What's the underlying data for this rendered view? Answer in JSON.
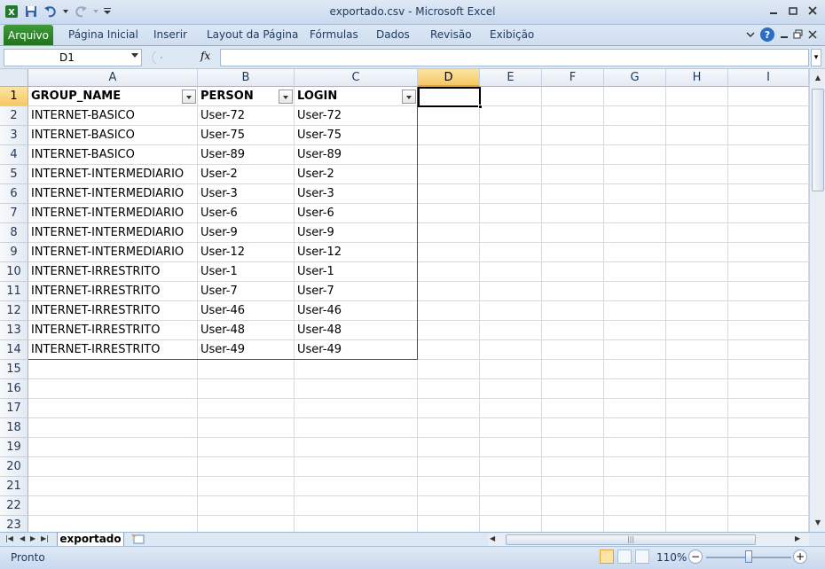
{
  "window": {
    "title": "exportado.csv  -  Microsoft Excel",
    "app_icon_letter": "X"
  },
  "ribbon": {
    "file_tab": "Arquivo",
    "tabs": [
      "Página Inicial",
      "Inserir",
      "Layout da Página",
      "Fórmulas",
      "Dados",
      "Revisão",
      "Exibição"
    ]
  },
  "formula_bar": {
    "name_box": "D1",
    "fx_label": "fx",
    "formula": ""
  },
  "grid": {
    "columns": [
      "A",
      "B",
      "C",
      "D",
      "E",
      "F",
      "G",
      "H",
      "I"
    ],
    "selected_column": "D",
    "selected_row": 1,
    "row_numbers": [
      1,
      2,
      3,
      4,
      5,
      6,
      7,
      8,
      9,
      10,
      11,
      12,
      13,
      14,
      15,
      16,
      17,
      18,
      19,
      20,
      21,
      22,
      23
    ],
    "headers": [
      "GROUP_NAME",
      "PERSON",
      "LOGIN"
    ],
    "rows": [
      [
        "INTERNET-BASICO",
        "User-72",
        "User-72"
      ],
      [
        "INTERNET-BASICO",
        "User-75",
        "User-75"
      ],
      [
        "INTERNET-BASICO",
        "User-89",
        "User-89"
      ],
      [
        "INTERNET-INTERMEDIARIO",
        "User-2",
        "User-2"
      ],
      [
        "INTERNET-INTERMEDIARIO",
        "User-3",
        "User-3"
      ],
      [
        "INTERNET-INTERMEDIARIO",
        "User-6",
        "User-6"
      ],
      [
        "INTERNET-INTERMEDIARIO",
        "User-9",
        "User-9"
      ],
      [
        "INTERNET-INTERMEDIARIO",
        "User-12",
        "User-12"
      ],
      [
        "INTERNET-IRRESTRITO",
        "User-1",
        "User-1"
      ],
      [
        "INTERNET-IRRESTRITO",
        "User-7",
        "User-7"
      ],
      [
        "INTERNET-IRRESTRITO",
        "User-46",
        "User-46"
      ],
      [
        "INTERNET-IRRESTRITO",
        "User-48",
        "User-48"
      ],
      [
        "INTERNET-IRRESTRITO",
        "User-49",
        "User-49"
      ]
    ]
  },
  "sheets": {
    "active": "exportado"
  },
  "status": {
    "text": "Pronto",
    "zoom": "110%"
  },
  "colors": {
    "file_tab": "#2a7d26",
    "selection_header": "#f6c864",
    "help_icon": "#2b6cc4"
  }
}
